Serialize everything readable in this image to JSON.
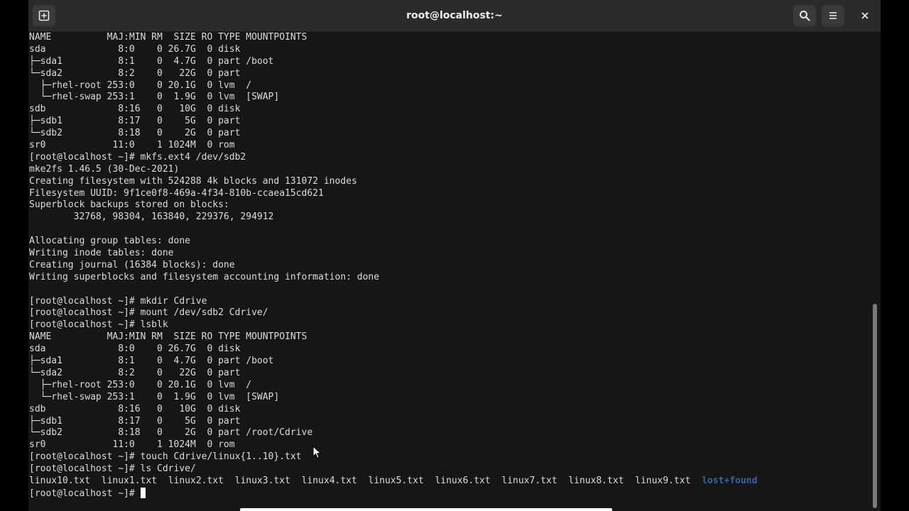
{
  "window": {
    "title": "root@localhost:~"
  },
  "titlebar": {
    "new_tab_icon": "new-tab-icon",
    "search_icon": "search-icon",
    "menu_icon": "hamburger-menu-icon",
    "close_icon": "close-icon"
  },
  "terminal": {
    "lines": [
      "NAME          MAJ:MIN RM  SIZE RO TYPE MOUNTPOINTS",
      "sda             8:0    0 26.7G  0 disk",
      "├─sda1          8:1    0  4.7G  0 part /boot",
      "└─sda2          8:2    0   22G  0 part",
      "  ├─rhel-root 253:0    0 20.1G  0 lvm  /",
      "  └─rhel-swap 253:1    0  1.9G  0 lvm  [SWAP]",
      "sdb             8:16   0   10G  0 disk",
      "├─sdb1          8:17   0    5G  0 part",
      "└─sdb2          8:18   0    2G  0 part",
      "sr0            11:0    1 1024M  0 rom",
      "[root@localhost ~]# mkfs.ext4 /dev/sdb2",
      "mke2fs 1.46.5 (30-Dec-2021)",
      "Creating filesystem with 524288 4k blocks and 131072 inodes",
      "Filesystem UUID: 9f1ce0f8-469a-4f34-810b-ccaea15cd621",
      "Superblock backups stored on blocks:",
      "        32768, 98304, 163840, 229376, 294912",
      "",
      "Allocating group tables: done",
      "Writing inode tables: done",
      "Creating journal (16384 blocks): done",
      "Writing superblocks and filesystem accounting information: done",
      "",
      "[root@localhost ~]# mkdir Cdrive",
      "[root@localhost ~]# mount /dev/sdb2 Cdrive/",
      "[root@localhost ~]# lsblk",
      "NAME          MAJ:MIN RM  SIZE RO TYPE MOUNTPOINTS",
      "sda             8:0    0 26.7G  0 disk",
      "├─sda1          8:1    0  4.7G  0 part /boot",
      "└─sda2          8:2    0   22G  0 part",
      "  ├─rhel-root 253:0    0 20.1G  0 lvm  /",
      "  └─rhel-swap 253:1    0  1.9G  0 lvm  [SWAP]",
      "sdb             8:16   0   10G  0 disk",
      "├─sdb1          8:17   0    5G  0 part",
      "└─sdb2          8:18   0    2G  0 part /root/Cdrive",
      "sr0            11:0    1 1024M  0 rom",
      "[root@localhost ~]# touch Cdrive/linux{1..10}.txt",
      "[root@localhost ~]# ls Cdrive/"
    ],
    "ls_output": {
      "files": [
        "linux10.txt",
        "linux1.txt",
        "linux2.txt",
        "linux3.txt",
        "linux4.txt",
        "linux5.txt",
        "linux6.txt",
        "linux7.txt",
        "linux8.txt",
        "linux9.txt"
      ],
      "directory": "lost+found",
      "directory_color": "#3465a4"
    },
    "prompt": "[root@localhost ~]# "
  }
}
